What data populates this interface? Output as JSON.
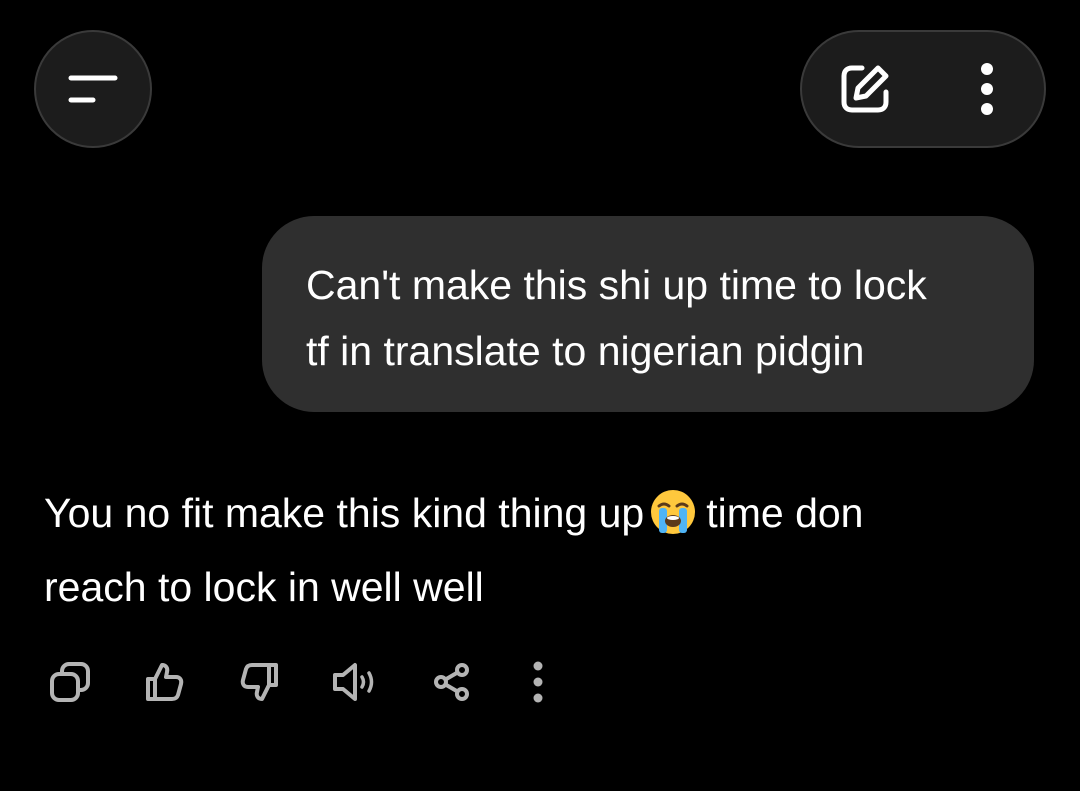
{
  "header": {
    "menu_icon": "menu-icon",
    "edit_icon": "new-chat-edit-icon",
    "more_icon": "more-vertical-icon"
  },
  "conversation": {
    "user_message": {
      "line1": "Can't make this shi up time to lock",
      "line2": "tf in translate to nigerian pidgin"
    },
    "assistant_message": {
      "before_emoji": "You no fit make this kind thing up",
      "emoji": "loudly-crying-face",
      "after_emoji": "time don",
      "line2": "reach to lock in well well"
    }
  },
  "message_actions": [
    {
      "icon": "copy-icon"
    },
    {
      "icon": "thumbs-up-icon"
    },
    {
      "icon": "thumbs-down-icon"
    },
    {
      "icon": "speaker-icon"
    },
    {
      "icon": "share-icon"
    },
    {
      "icon": "more-vertical-icon"
    }
  ],
  "colors": {
    "background": "#000000",
    "user_bubble": "#2f2f2f",
    "button_surface": "#1c1c1c",
    "icon": "#ffffff",
    "action_icon": "#b4b4b4"
  }
}
